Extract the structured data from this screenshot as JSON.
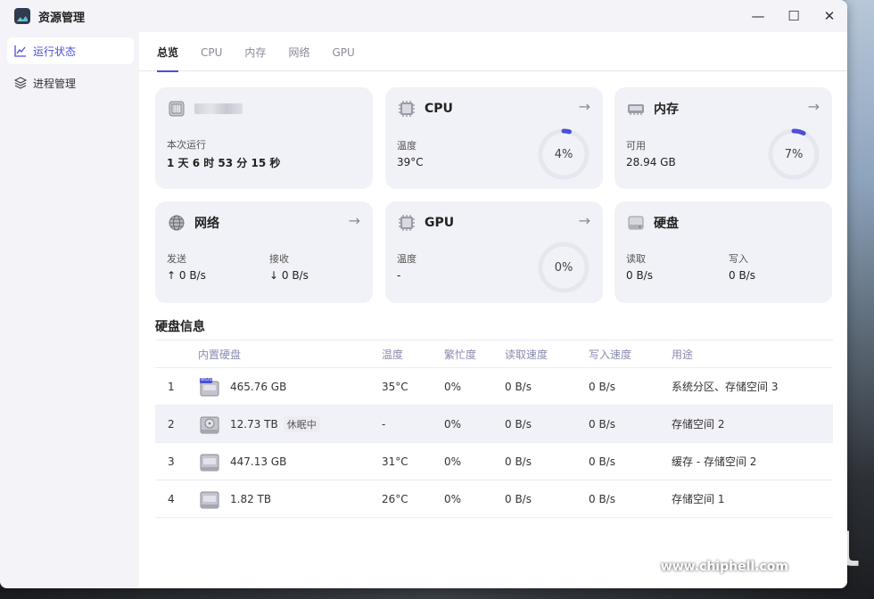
{
  "app": {
    "title": "资源管理"
  },
  "window_controls": {
    "minimize": "—",
    "maximize": "☐",
    "close": "✕"
  },
  "sidebar": {
    "items": [
      {
        "label": "运行状态",
        "icon": "line-chart-icon",
        "active": true
      },
      {
        "label": "进程管理",
        "icon": "layers-icon",
        "active": false
      }
    ]
  },
  "tabs": [
    {
      "label": "总览",
      "active": true
    },
    {
      "label": "CPU",
      "active": false
    },
    {
      "label": "内存",
      "active": false
    },
    {
      "label": "网络",
      "active": false
    },
    {
      "label": "GPU",
      "active": false
    }
  ],
  "cards": {
    "system": {
      "uptime_label": "本次运行",
      "uptime_value": "1 天 6 时 53 分 15 秒"
    },
    "cpu": {
      "title": "CPU",
      "temp_label": "温度",
      "temp_value": "39°C",
      "usage": "4%",
      "usage_pct": 4
    },
    "memory": {
      "title": "内存",
      "avail_label": "可用",
      "avail_value": "28.94 GB",
      "usage": "7%",
      "usage_pct": 7
    },
    "network": {
      "title": "网络",
      "send_label": "发送",
      "send_value": "↑ 0 B/s",
      "recv_label": "接收",
      "recv_value": "↓ 0 B/s"
    },
    "gpu": {
      "title": "GPU",
      "temp_label": "温度",
      "temp_value": "-",
      "usage": "0%",
      "usage_pct": 0
    },
    "disk": {
      "title": "硬盘",
      "read_label": "读取",
      "read_value": "0 B/s",
      "write_label": "写入",
      "write_value": "0 B/s"
    }
  },
  "disk_info": {
    "title": "硬盘信息",
    "columns": [
      "内置硬盘",
      "温度",
      "繁忙度",
      "读取速度",
      "写入速度",
      "用途"
    ],
    "rows": [
      {
        "idx": "1",
        "size": "465.76 GB",
        "badge": "",
        "icon_tag": "BtOS",
        "temp": "35°C",
        "busy": "0%",
        "read": "0 B/s",
        "write": "0 B/s",
        "usage": "系统分区、存储空间 3"
      },
      {
        "idx": "2",
        "size": "12.73 TB",
        "badge": "休眠中",
        "icon_tag": "",
        "temp": "-",
        "busy": "0%",
        "read": "0 B/s",
        "write": "0 B/s",
        "usage": "存储空间 2"
      },
      {
        "idx": "3",
        "size": "447.13 GB",
        "badge": "",
        "icon_tag": "",
        "temp": "31°C",
        "busy": "0%",
        "read": "0 B/s",
        "write": "0 B/s",
        "usage": "缓存 - 存储空间 2"
      },
      {
        "idx": "4",
        "size": "1.82 TB",
        "badge": "",
        "icon_tag": "",
        "temp": "26°C",
        "busy": "0%",
        "read": "0 B/s",
        "write": "0 B/s",
        "usage": "存储空间 1"
      }
    ]
  },
  "watermark": {
    "logo": "chip hell",
    "url": "www.chiphell.com"
  },
  "colors": {
    "accent": "#4a50d8",
    "card_bg": "#f1f1f8",
    "sidebar_bg": "#f3f3f8",
    "ring_track": "#e6e6ee"
  }
}
